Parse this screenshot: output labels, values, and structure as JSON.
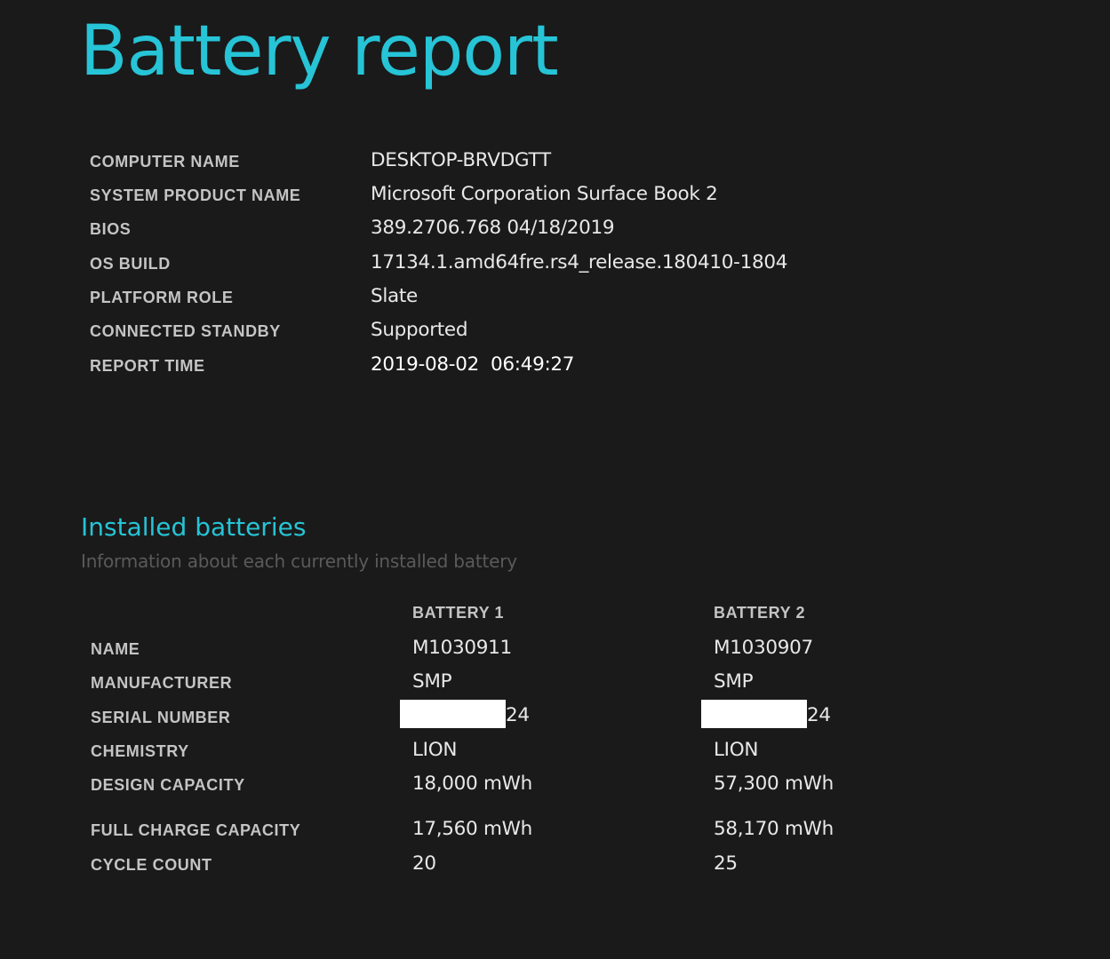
{
  "page": {
    "title": "Battery report"
  },
  "system_info": [
    {
      "label": "COMPUTER NAME",
      "value": "DESKTOP-BRVDGTT"
    },
    {
      "label": "SYSTEM PRODUCT NAME",
      "value": "Microsoft Corporation Surface Book 2"
    },
    {
      "label": "BIOS",
      "value": "389.2706.768 04/18/2019"
    },
    {
      "label": "OS BUILD",
      "value": "17134.1.amd64fre.rs4_release.180410-1804"
    },
    {
      "label": "PLATFORM ROLE",
      "value": "Slate"
    },
    {
      "label": "CONNECTED STANDBY",
      "value": "Supported"
    },
    {
      "label": "REPORT TIME",
      "value": "2019-08-02  06:49:27"
    }
  ],
  "installed_batteries": {
    "title": "Installed batteries",
    "subtitle": "Information about each currently installed battery",
    "columns": [
      "BATTERY 1",
      "BATTERY 2"
    ],
    "rows": [
      {
        "label": "NAME",
        "values": [
          "M1030911",
          "M1030907"
        ]
      },
      {
        "label": "MANUFACTURER",
        "values": [
          "SMP",
          "SMP"
        ]
      },
      {
        "label": "SERIAL NUMBER",
        "values": [
          "24",
          "24"
        ],
        "redacted_prefix": true
      },
      {
        "label": "CHEMISTRY",
        "values": [
          "LION",
          "LION"
        ]
      },
      {
        "label": "DESIGN CAPACITY",
        "values": [
          "18,000 mWh",
          "57,300 mWh"
        ]
      },
      {
        "label": "FULL CHARGE CAPACITY",
        "values": [
          "17,560 mWh",
          "58,170 mWh"
        ]
      },
      {
        "label": "CYCLE COUNT",
        "values": [
          "20",
          "25"
        ]
      }
    ]
  },
  "colors": {
    "background": "#1a1a1a",
    "accent": "#26c4d6",
    "label": "#c4c4c4",
    "value": "#e8e8e8",
    "subtitle": "#5a5a5a",
    "redaction": "#ffffff"
  }
}
